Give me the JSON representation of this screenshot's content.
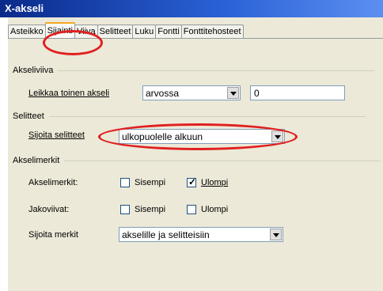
{
  "window": {
    "title": "X-akseli"
  },
  "tabs": [
    {
      "label": "Asteikko"
    },
    {
      "label": "Sijainti"
    },
    {
      "label": "Viiva"
    },
    {
      "label": "Selitteet"
    },
    {
      "label": "Luku"
    },
    {
      "label": "Fontti"
    },
    {
      "label": "Fonttitehosteet"
    }
  ],
  "axis_line": {
    "section_label": "Akseliviiva",
    "cross_label": "Leikkaa toinen akseli",
    "cross_select_value": "arvossa",
    "cross_value": "0"
  },
  "labels": {
    "section_label": "Selitteet",
    "place_label": "Sijoita selitteet",
    "place_select_value": "ulkopuolelle alkuun"
  },
  "marks": {
    "section_label": "Akselimerkit",
    "major_label": "Akselimerkit:",
    "minor_label": "Jakoviivat:",
    "inner_label": "Sisempi",
    "outer_label": "Ulompi",
    "major_inner_checked": false,
    "major_outer_checked": true,
    "minor_inner_checked": false,
    "minor_outer_checked": false,
    "place_marks_label": "Sijoita merkit",
    "place_marks_value": "akselille ja selitteisiin"
  },
  "colors": {
    "highlight_circle": "#e02020",
    "titlebar": "#0a2a8a"
  }
}
